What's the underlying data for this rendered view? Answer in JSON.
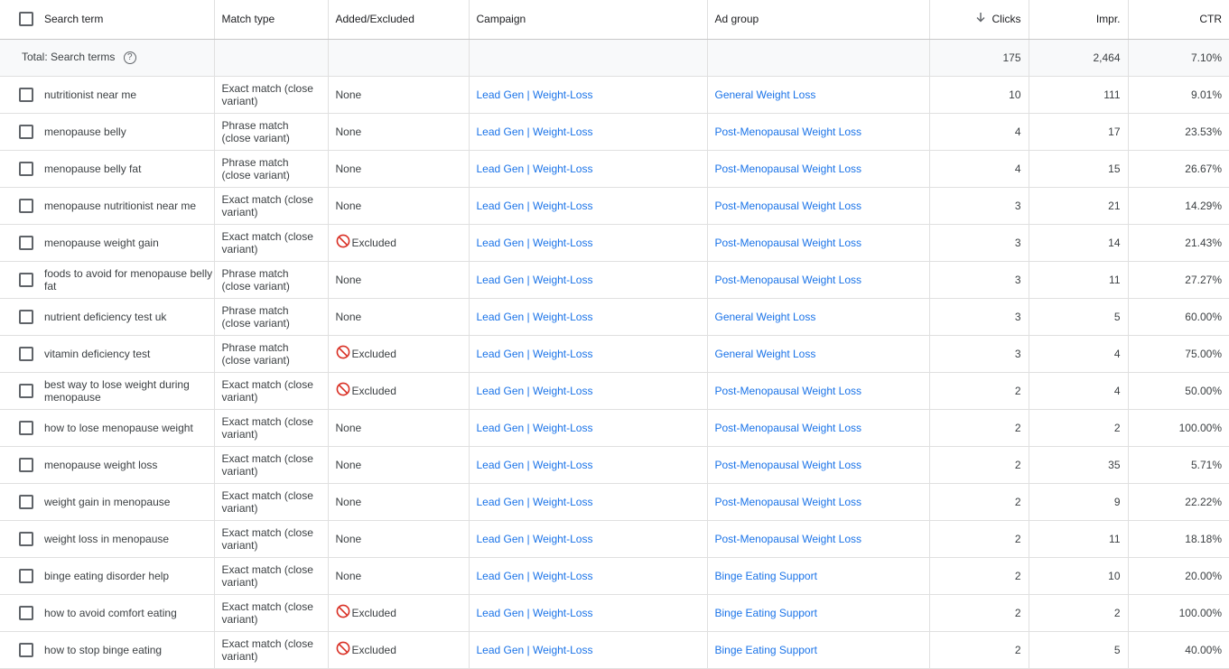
{
  "header": {
    "search_term": "Search term",
    "match_type": "Match type",
    "added_excluded": "Added/Excluded",
    "campaign": "Campaign",
    "ad_group": "Ad group",
    "clicks": "Clicks",
    "impr": "Impr.",
    "ctr": "CTR"
  },
  "total": {
    "label": "Total: Search terms",
    "clicks": "175",
    "impr": "2,464",
    "ctr": "7.10%"
  },
  "icons": {
    "sort": "arrow-down-icon",
    "help": "help-circle-icon",
    "excluded": "prohibited-icon"
  },
  "colors": {
    "link": "#1a73e8",
    "excluded": "#d93025"
  },
  "rows": [
    {
      "term": "nutritionist near me",
      "match": "Exact match (close variant)",
      "status": "None",
      "campaign": "Lead Gen | Weight-Loss",
      "ad_group": "General Weight Loss",
      "clicks": "10",
      "impr": "111",
      "ctr": "9.01%"
    },
    {
      "term": "menopause belly",
      "match": "Phrase match (close variant)",
      "status": "None",
      "campaign": "Lead Gen | Weight-Loss",
      "ad_group": "Post-Menopausal Weight Loss",
      "clicks": "4",
      "impr": "17",
      "ctr": "23.53%"
    },
    {
      "term": "menopause belly fat",
      "match": "Phrase match (close variant)",
      "status": "None",
      "campaign": "Lead Gen | Weight-Loss",
      "ad_group": "Post-Menopausal Weight Loss",
      "clicks": "4",
      "impr": "15",
      "ctr": "26.67%"
    },
    {
      "term": "menopause nutritionist near me",
      "match": "Exact match (close variant)",
      "status": "None",
      "campaign": "Lead Gen | Weight-Loss",
      "ad_group": "Post-Menopausal Weight Loss",
      "clicks": "3",
      "impr": "21",
      "ctr": "14.29%"
    },
    {
      "term": "menopause weight gain",
      "match": "Exact match (close variant)",
      "status": "Excluded",
      "campaign": "Lead Gen | Weight-Loss",
      "ad_group": "Post-Menopausal Weight Loss",
      "clicks": "3",
      "impr": "14",
      "ctr": "21.43%"
    },
    {
      "term": "foods to avoid for menopause belly fat",
      "match": "Phrase match (close variant)",
      "status": "None",
      "campaign": "Lead Gen | Weight-Loss",
      "ad_group": "Post-Menopausal Weight Loss",
      "clicks": "3",
      "impr": "11",
      "ctr": "27.27%"
    },
    {
      "term": "nutrient deficiency test uk",
      "match": "Phrase match (close variant)",
      "status": "None",
      "campaign": "Lead Gen | Weight-Loss",
      "ad_group": "General Weight Loss",
      "clicks": "3",
      "impr": "5",
      "ctr": "60.00%"
    },
    {
      "term": "vitamin deficiency test",
      "match": "Phrase match (close variant)",
      "status": "Excluded",
      "campaign": "Lead Gen | Weight-Loss",
      "ad_group": "General Weight Loss",
      "clicks": "3",
      "impr": "4",
      "ctr": "75.00%"
    },
    {
      "term": "best way to lose weight during menopause",
      "match": "Exact match (close variant)",
      "status": "Excluded",
      "campaign": "Lead Gen | Weight-Loss",
      "ad_group": "Post-Menopausal Weight Loss",
      "clicks": "2",
      "impr": "4",
      "ctr": "50.00%"
    },
    {
      "term": "how to lose menopause weight",
      "match": "Exact match (close variant)",
      "status": "None",
      "campaign": "Lead Gen | Weight-Loss",
      "ad_group": "Post-Menopausal Weight Loss",
      "clicks": "2",
      "impr": "2",
      "ctr": "100.00%"
    },
    {
      "term": "menopause weight loss",
      "match": "Exact match (close variant)",
      "status": "None",
      "campaign": "Lead Gen | Weight-Loss",
      "ad_group": "Post-Menopausal Weight Loss",
      "clicks": "2",
      "impr": "35",
      "ctr": "5.71%"
    },
    {
      "term": "weight gain in menopause",
      "match": "Exact match (close variant)",
      "status": "None",
      "campaign": "Lead Gen | Weight-Loss",
      "ad_group": "Post-Menopausal Weight Loss",
      "clicks": "2",
      "impr": "9",
      "ctr": "22.22%"
    },
    {
      "term": "weight loss in menopause",
      "match": "Exact match (close variant)",
      "status": "None",
      "campaign": "Lead Gen | Weight-Loss",
      "ad_group": "Post-Menopausal Weight Loss",
      "clicks": "2",
      "impr": "11",
      "ctr": "18.18%"
    },
    {
      "term": "binge eating disorder help",
      "match": "Exact match (close variant)",
      "status": "None",
      "campaign": "Lead Gen | Weight-Loss",
      "ad_group": "Binge Eating Support",
      "clicks": "2",
      "impr": "10",
      "ctr": "20.00%"
    },
    {
      "term": "how to avoid comfort eating",
      "match": "Exact match (close variant)",
      "status": "Excluded",
      "campaign": "Lead Gen | Weight-Loss",
      "ad_group": "Binge Eating Support",
      "clicks": "2",
      "impr": "2",
      "ctr": "100.00%"
    },
    {
      "term": "how to stop binge eating",
      "match": "Exact match (close variant)",
      "status": "Excluded",
      "campaign": "Lead Gen | Weight-Loss",
      "ad_group": "Binge Eating Support",
      "clicks": "2",
      "impr": "5",
      "ctr": "40.00%"
    }
  ]
}
